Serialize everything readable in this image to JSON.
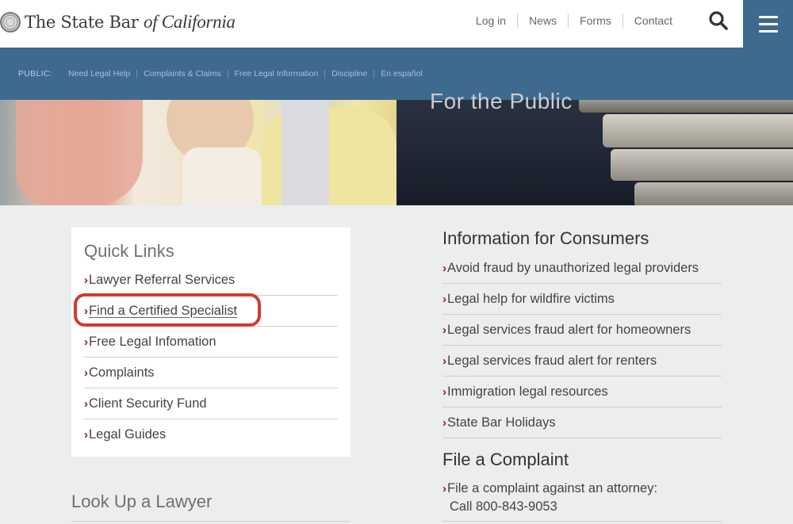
{
  "header": {
    "logo_part1": "The State Bar",
    "logo_part2": "of California",
    "nav": [
      "Log in",
      "News",
      "Forms",
      "Contact"
    ]
  },
  "subnav": {
    "label": "PUBLIC:",
    "items": [
      "Need Legal Help",
      "Complaints & Claims",
      "Free Legal Information",
      "Discipline",
      "En español"
    ]
  },
  "hero": {
    "title": "For the Public"
  },
  "quick_links": {
    "title": "Quick Links",
    "items": [
      "Lawyer Referral Services",
      "Find a Certified Specialist",
      "Free Legal Infomation",
      "Complaints",
      "Client Security Fund",
      "Legal Guides"
    ]
  },
  "lookup": {
    "title": "Look Up a Lawyer"
  },
  "consumers": {
    "title": "Information for Consumers",
    "items": [
      "Avoid fraud by unauthorized legal providers",
      "Legal help for wildfire victims",
      "Legal services fraud alert for homeowners",
      "Legal services fraud alert for renters",
      "Immigration legal resources",
      "State Bar Holidays"
    ]
  },
  "complaint": {
    "title": "File a Complaint",
    "line1": "File a complaint against an attorney:",
    "line2": "Call 800-843-9053"
  },
  "colors": {
    "brand_blue": "#3f6a8f",
    "chevron": "#8a1c2a",
    "highlight": "#d23a2e"
  },
  "icons": {
    "search": "search-icon",
    "menu": "hamburger-menu-icon",
    "seal": "state-bar-seal-icon",
    "chevron": "chevron-right-icon"
  }
}
